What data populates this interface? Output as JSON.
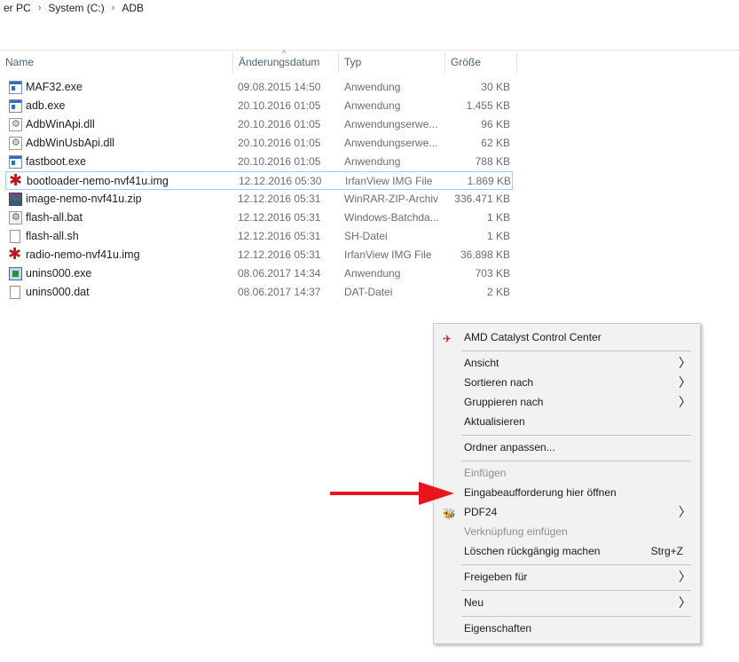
{
  "breadcrumb": {
    "items": [
      "er PC",
      "System (C:)",
      "ADB"
    ],
    "separator": "›"
  },
  "columns": {
    "name": "Name",
    "date": "Änderungsdatum",
    "type": "Typ",
    "size": "Größe",
    "sort_indicator": "^"
  },
  "files": [
    {
      "name": "MAF32.exe",
      "date": "09.08.2015 14:50",
      "type": "Anwendung",
      "size": "30 KB",
      "icon": "exe-icon"
    },
    {
      "name": "adb.exe",
      "date": "20.10.2016 01:05",
      "type": "Anwendung",
      "size": "1.455 KB",
      "icon": "exe-icon"
    },
    {
      "name": "AdbWinApi.dll",
      "date": "20.10.2016 01:05",
      "type": "Anwendungserwe...",
      "size": "96 KB",
      "icon": "dll-icon"
    },
    {
      "name": "AdbWinUsbApi.dll",
      "date": "20.10.2016 01:05",
      "type": "Anwendungserwe...",
      "size": "62 KB",
      "icon": "dll-icon"
    },
    {
      "name": "fastboot.exe",
      "date": "20.10.2016 01:05",
      "type": "Anwendung",
      "size": "788 KB",
      "icon": "exe-icon"
    },
    {
      "name": "bootloader-nemo-nvf41u.img",
      "date": "12.12.2016 05:30",
      "type": "IrfanView IMG File",
      "size": "1.869 KB",
      "icon": "irfanview-img-icon",
      "selected": true
    },
    {
      "name": "image-nemo-nvf41u.zip",
      "date": "12.12.2016 05:31",
      "type": "WinRAR-ZIP-Archiv",
      "size": "336.471 KB",
      "icon": "winrar-zip-icon"
    },
    {
      "name": "flash-all.bat",
      "date": "12.12.2016 05:31",
      "type": "Windows-Batchda...",
      "size": "1 KB",
      "icon": "batch-file-icon"
    },
    {
      "name": "flash-all.sh",
      "date": "12.12.2016 05:31",
      "type": "SH-Datei",
      "size": "1 KB",
      "icon": "file-icon"
    },
    {
      "name": "radio-nemo-nvf41u.img",
      "date": "12.12.2016 05:31",
      "type": "IrfanView IMG File",
      "size": "36.898 KB",
      "icon": "irfanview-img-icon"
    },
    {
      "name": "unins000.exe",
      "date": "08.06.2017 14:34",
      "type": "Anwendung",
      "size": "703 KB",
      "icon": "setup-exe-icon"
    },
    {
      "name": "unins000.dat",
      "date": "08.06.2017 14:37",
      "type": "DAT-Datei",
      "size": "2 KB",
      "icon": "file-icon"
    }
  ],
  "context_menu": {
    "items": {
      "amd": "AMD Catalyst Control Center",
      "ansicht": "Ansicht",
      "sortieren": "Sortieren nach",
      "gruppieren": "Gruppieren nach",
      "aktualisieren": "Aktualisieren",
      "ordner_anpassen": "Ordner anpassen...",
      "einfuegen": "Einfügen",
      "eingabeaufforderung": "Eingabeaufforderung hier öffnen",
      "pdf24": "PDF24",
      "verknuepfung": "Verknüpfung einfügen",
      "loeschen_rueckgaengig": "Löschen rückgängig machen",
      "loeschen_shortcut": "Strg+Z",
      "freigeben": "Freigeben für",
      "neu": "Neu",
      "eigenschaften": "Eigenschaften"
    },
    "submenu_glyph": "〉"
  },
  "colors": {
    "annotation_arrow": "#e8161c",
    "selection_border": "#99d1ff",
    "header_text": "#4c607a"
  }
}
